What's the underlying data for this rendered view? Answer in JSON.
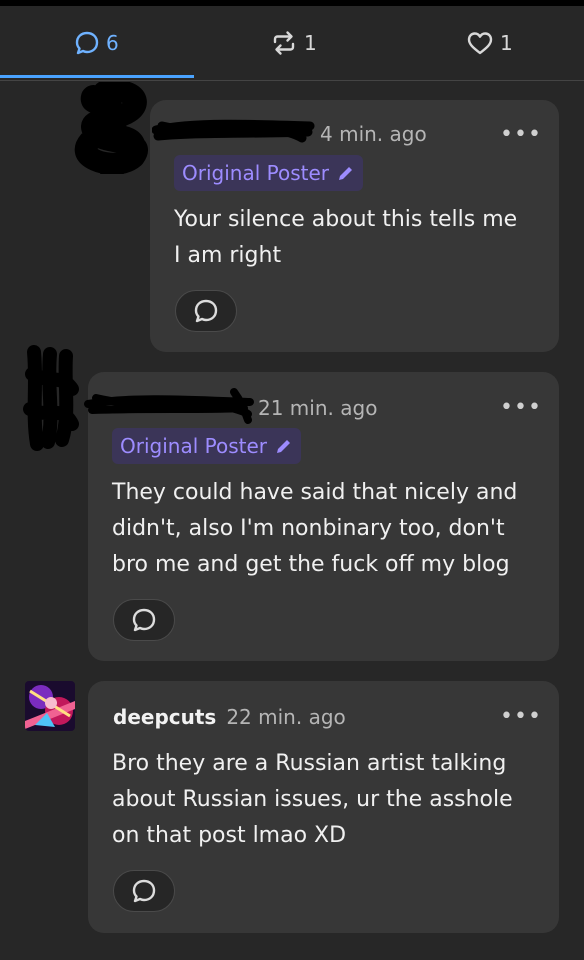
{
  "tabs": {
    "comments_count": "6",
    "reblogs_count": "1",
    "likes_count": "1"
  },
  "comments": [
    {
      "time": "4 min. ago",
      "badge": "Original Poster",
      "text_lines": [
        "Your silence about this tells me",
        "I am right"
      ]
    },
    {
      "time": "21 min. ago",
      "badge": "Original Poster",
      "text_lines": [
        "They could have said that nicely and",
        "didn't, also I'm nonbinary too, don't",
        "bro me and get the fuck off my blog"
      ]
    },
    {
      "author": "deepcuts",
      "time": "22 min. ago",
      "text_lines": [
        "Bro they are a Russian artist talking",
        "about Russian issues, ur the asshole",
        "on that post lmao XD"
      ]
    }
  ],
  "more_glyph": "•••",
  "colors": {
    "accent": "#4aa3ff",
    "badge_text": "#9d8cff",
    "badge_bg": "#3b3558",
    "card_bg": "#373737",
    "page_bg": "#272727"
  }
}
